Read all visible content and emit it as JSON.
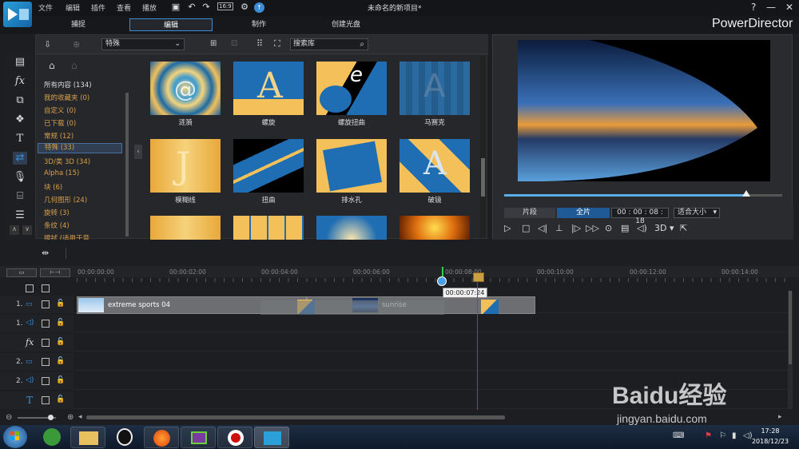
{
  "menu": [
    "文件",
    "编辑",
    "插件",
    "查看",
    "播放"
  ],
  "window_title": "未命名的新项目*",
  "toolbar_resolution": "16:9",
  "modes": [
    "捕捉",
    "编辑",
    "制作",
    "创建光盘"
  ],
  "brand": "PowerDirector",
  "library": {
    "category_combo": "特殊",
    "search_placeholder": "搜索库",
    "categories": [
      "所有内容 (134)",
      "我的收藏夹 (0)",
      "自定义 (0)",
      "已下载 (0)",
      "常规 (12)",
      "特殊 (33)",
      "3D/类 3D (34)",
      "Alpha (15)",
      "块 (6)",
      "几何图形 (24)",
      "旋转 (3)",
      "条纹 (4)",
      "擦拭 (适用于音..."
    ],
    "active_category": "特殊 (33)",
    "thumb_labels": [
      "涟漪",
      "螺旋",
      "螺旋扭曲",
      "马赛克",
      "模糊线",
      "扭曲",
      "排水孔",
      "破镜"
    ]
  },
  "preview": {
    "mode_clip": "片段",
    "mode_movie": "全片",
    "timecode": "00 : 00 : 08 : 18",
    "fit": "适合大小",
    "three_d": "3D",
    "progress": 0.87
  },
  "timeline": {
    "ruler": [
      "00:00:00:00",
      "00:00:02:00",
      "00:00:04:00",
      "00:00:06:00",
      "00:00:08:00",
      "00:00:10:00",
      "00:00:12:00",
      "00:00:14:00"
    ],
    "tooltip": "00:00:07:24",
    "tracks": [
      {
        "label": "1.",
        "type": "video"
      },
      {
        "label": "1.",
        "type": "audio"
      },
      {
        "label": "",
        "type": "fx"
      },
      {
        "label": "2.",
        "type": "video"
      },
      {
        "label": "2.",
        "type": "audio"
      },
      {
        "label": "",
        "type": "title"
      }
    ],
    "clips": [
      "extreme sports 04",
      "sunrise"
    ]
  },
  "taskbar": {
    "time": "17:28",
    "date": "2018/12/23"
  },
  "watermark": {
    "main": "Baidu经验",
    "sub": "jingyan.baidu.com"
  },
  "colors": {
    "accent": "#3c8dd6",
    "highlight": "#d8a048",
    "playhead": "#c03030"
  }
}
